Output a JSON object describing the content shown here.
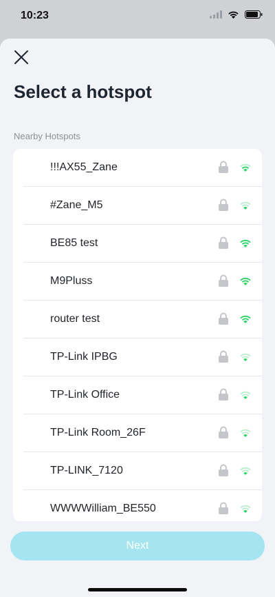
{
  "status_bar": {
    "time": "10:23"
  },
  "header": {
    "title": "Select a hotspot"
  },
  "section": {
    "label": "Nearby Hotspots"
  },
  "hotspots": [
    {
      "name": "!!!AX55_Zane",
      "locked": true,
      "signal": "medium"
    },
    {
      "name": "#Zane_M5",
      "locked": true,
      "signal": "weak"
    },
    {
      "name": "BE85 test",
      "locked": true,
      "signal": "strong"
    },
    {
      "name": "M9Pluss",
      "locked": true,
      "signal": "strong"
    },
    {
      "name": "router test",
      "locked": true,
      "signal": "strong"
    },
    {
      "name": "TP-Link IPBG",
      "locked": true,
      "signal": "weak"
    },
    {
      "name": "TP-Link Office",
      "locked": true,
      "signal": "weak"
    },
    {
      "name": "TP-Link Room_26F",
      "locked": true,
      "signal": "weak"
    },
    {
      "name": "TP-LINK_7120",
      "locked": true,
      "signal": "weak"
    },
    {
      "name": "WWWWilliam_BE550",
      "locked": true,
      "signal": "weak"
    }
  ],
  "footer": {
    "next_label": "Next"
  },
  "colors": {
    "accent_disabled": "#a4e5f0",
    "wifi_green": "#2fd36a",
    "wifi_faded": "#bfeecf",
    "lock_gray": "#c4c6ca"
  }
}
